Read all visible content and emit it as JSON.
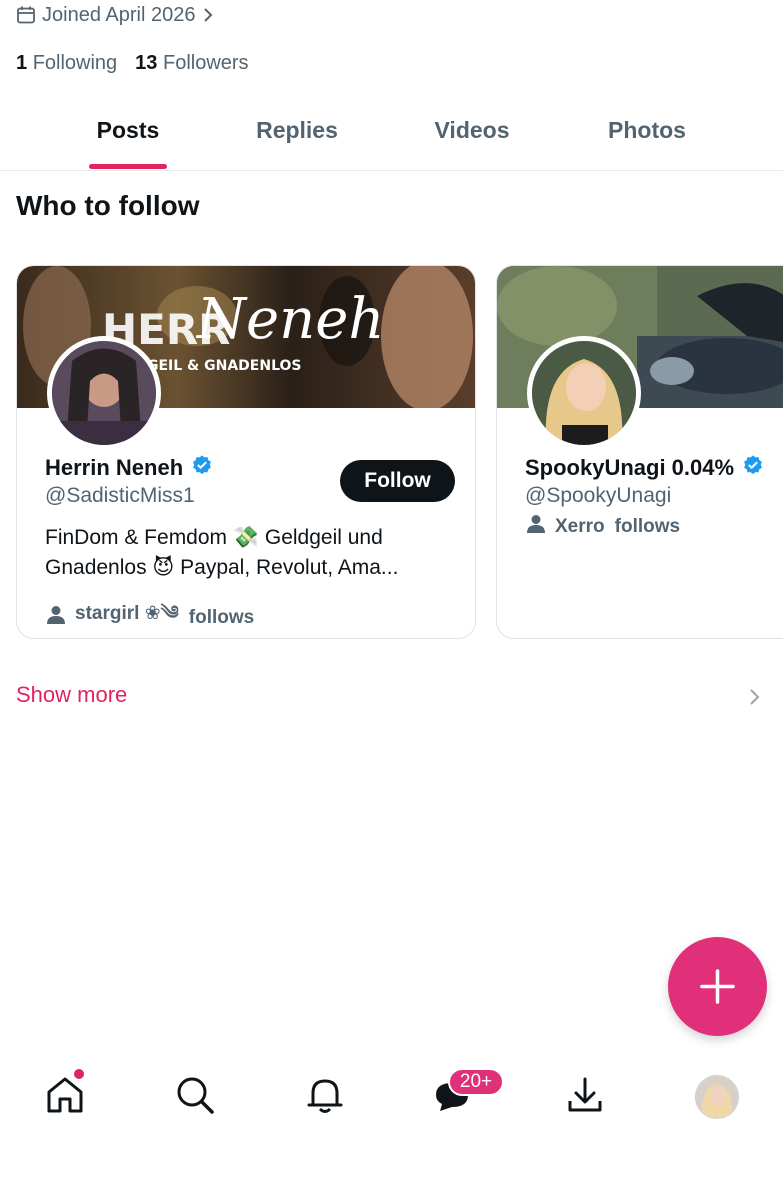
{
  "profile": {
    "joined": "Joined April 2026",
    "following_count": "1",
    "following_label": "Following",
    "followers_count": "13",
    "followers_label": "Followers"
  },
  "tabs": [
    {
      "label": "Posts",
      "active": true
    },
    {
      "label": "Replies",
      "active": false
    },
    {
      "label": "Videos",
      "active": false
    },
    {
      "label": "Photos",
      "active": false
    }
  ],
  "who_to_follow": {
    "title": "Who to follow",
    "cards": [
      {
        "name": "Herrin Neneh",
        "handle": "@SadisticMiss1",
        "bio_line1": "FinDom & Femdom 💸 Geldgeil und",
        "bio_line2": "Gnadenlos 😈 Paypal, Revolut, Ama...",
        "follows_user": "stargirl ❀༄",
        "follows_suffix": "follows",
        "follow_button": "Follow",
        "banner_text": "GEIL & GNADENLOS",
        "banner_script": "Neneh",
        "verified": true
      },
      {
        "name": "SpookyUnagi 0.04%",
        "handle": "@SpookyUnagi",
        "follows_user": "Xerro",
        "follows_suffix": "follows",
        "verified": true
      }
    ],
    "show_more": "Show more"
  },
  "nav": {
    "messages_badge": "20+",
    "items": [
      "home-icon",
      "search-icon",
      "bell-icon",
      "messages-icon",
      "download-icon",
      "profile-avatar"
    ]
  },
  "colors": {
    "accent": "#e0245e",
    "fab": "#e0307a",
    "verified": "#1d9bf0",
    "text": "#0f1419",
    "muted": "#536471"
  }
}
